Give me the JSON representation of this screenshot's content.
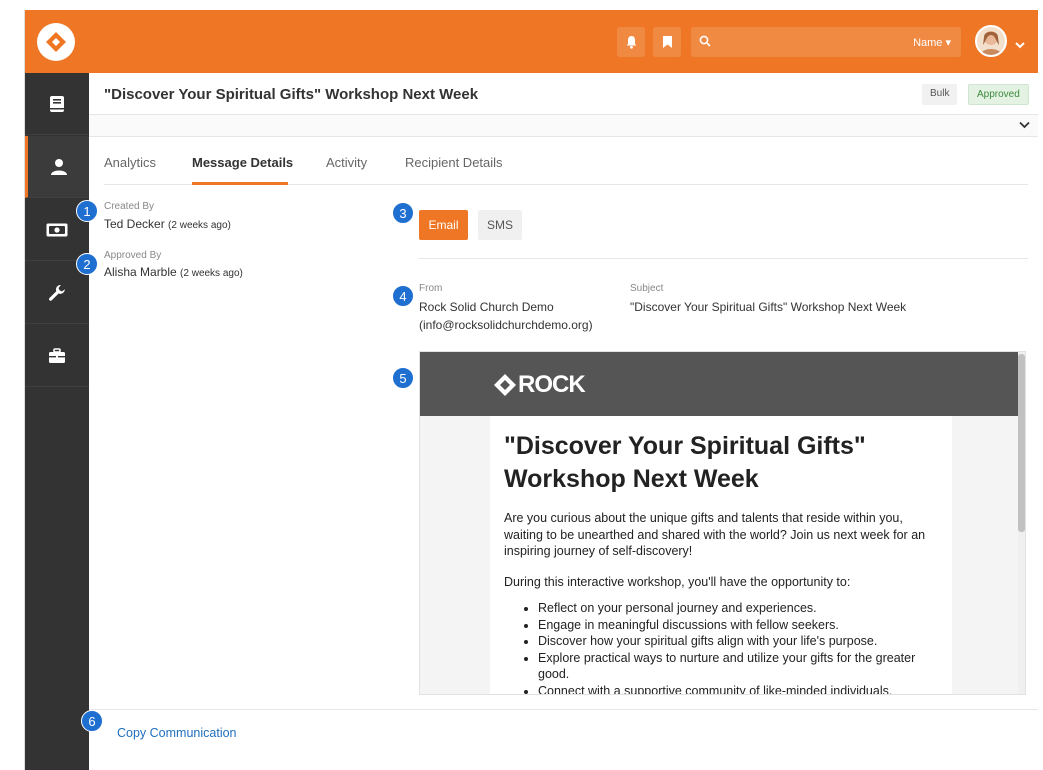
{
  "topbar": {
    "search_placeholder": "",
    "search_filter_label": "Name ▾"
  },
  "header": {
    "title": "\"Discover Your Spiritual Gifts\" Workshop Next Week",
    "badge_bulk": "Bulk",
    "badge_status": "Approved"
  },
  "tabs": [
    {
      "label": "Analytics"
    },
    {
      "label": "Message Details"
    },
    {
      "label": "Activity"
    },
    {
      "label": "Recipient Details"
    }
  ],
  "details": {
    "created_by_label": "Created By",
    "created_by_name": "Ted Decker",
    "created_by_time": "(2 weeks ago)",
    "approved_by_label": "Approved By",
    "approved_by_name": "Alisha Marble",
    "approved_by_time": "(2 weeks ago)"
  },
  "medium": {
    "email_label": "Email",
    "sms_label": "SMS"
  },
  "message": {
    "from_label": "From",
    "from_name": "Rock Solid Church Demo",
    "from_email": "(info@rocksolidchurchdemo.org)",
    "subject_label": "Subject",
    "subject_value": "\"Discover Your Spiritual Gifts\" Workshop Next Week"
  },
  "preview": {
    "brand": "ROCK",
    "title": "\"Discover Your Spiritual Gifts\" Workshop Next Week",
    "paragraph1": "Are you curious about the unique gifts and talents that reside within you, waiting to be unearthed and shared with the world? Join us next week for an inspiring journey of self-discovery!",
    "paragraph2": "During this interactive workshop, you'll have the opportunity to:",
    "bullets": [
      "Reflect on your personal journey and experiences.",
      "Engage in meaningful discussions with fellow seekers.",
      "Discover how your spiritual gifts align with your life's purpose.",
      "Explore practical ways to nurture and utilize your gifts for the greater good.",
      "Connect with a supportive community of like-minded individuals."
    ]
  },
  "footer": {
    "copy_label": "Copy Communication"
  },
  "callouts": [
    "1",
    "2",
    "3",
    "4",
    "5",
    "6"
  ],
  "colors": {
    "brand_orange": "#ee7624",
    "sidebar": "#333333",
    "callout_blue": "#1f6fd1",
    "link_blue": "#1f6fbe"
  }
}
